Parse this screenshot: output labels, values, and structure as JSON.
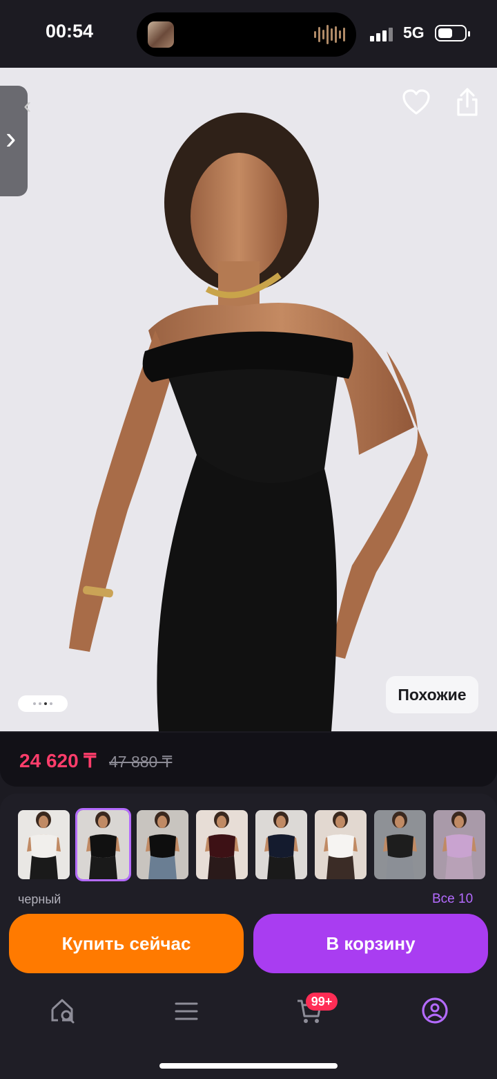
{
  "status_bar": {
    "time": "00:54",
    "network": "5G",
    "battery_level": 0.55
  },
  "product": {
    "price": "24 620 ₸",
    "old_price": "47 880 ₸",
    "similar_label": "Похожие",
    "gallery_dots": {
      "count": 4,
      "active": 2
    }
  },
  "variants": {
    "selected_color": "черный",
    "all_label": "Все 10",
    "selected_index": 1,
    "items": [
      {
        "name": "variant-1",
        "top": "#f1efec",
        "bottom": "#1a1a1a",
        "bg": "#e9e7e4"
      },
      {
        "name": "variant-2",
        "top": "#111111",
        "bottom": "#1a1a1a",
        "bg": "#d9d6d3"
      },
      {
        "name": "variant-3",
        "top": "#0e0e0e",
        "bottom": "#6a7e93",
        "bg": "#c8c4bf"
      },
      {
        "name": "variant-4",
        "top": "#3d1115",
        "bottom": "#2a1a1a",
        "bg": "#e7ddd6"
      },
      {
        "name": "variant-5",
        "top": "#141b2e",
        "bottom": "#1a1a1a",
        "bg": "#dcd9d6"
      },
      {
        "name": "variant-6",
        "top": "#f6f4f2",
        "bottom": "#3b2c26",
        "bg": "#e2d8d0"
      },
      {
        "name": "variant-7",
        "top": "#1d1d1d",
        "bottom": "#8b8f96",
        "bg": "#8e9196"
      },
      {
        "name": "variant-8",
        "top": "#c9a3d0",
        "bottom": "#b8a1b7",
        "bg": "#a99aa9"
      }
    ]
  },
  "actions": {
    "buy_now": "Купить сейчас",
    "add_to_cart": "В корзину"
  },
  "tab_bar": {
    "cart_badge": "99+"
  },
  "colors": {
    "price": "#ff3d6b",
    "accent": "#a93df1",
    "buy": "#ff7a00"
  }
}
